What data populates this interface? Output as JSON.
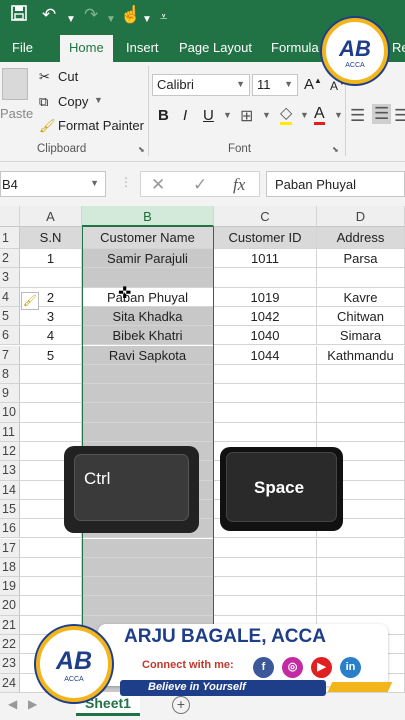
{
  "quick_access": {
    "save_icon": "save-icon",
    "undo_icon": "undo-icon",
    "redo_icon": "redo-icon",
    "touch_icon": "touch-mode-icon",
    "customize_icon": "customize-icon"
  },
  "tabs": [
    {
      "label": "File"
    },
    {
      "label": "Home"
    },
    {
      "label": "Insert"
    },
    {
      "label": "Page Layout"
    },
    {
      "label": "Formula"
    },
    {
      "label": "Re"
    }
  ],
  "clipboard": {
    "paste": "Paste",
    "cut": "Cut",
    "copy": "Copy",
    "format_painter": "Format Painter",
    "group": "Clipboard"
  },
  "font": {
    "name": "Calibri",
    "size": "11",
    "bold": "B",
    "italic": "I",
    "underline": "U",
    "font_color": "A",
    "group": "Font"
  },
  "formula_bar": {
    "name_box": "B4",
    "cancel": "✕",
    "enter": "✓",
    "fx": "fx",
    "value": "Paban Phuyal"
  },
  "columns": [
    "A",
    "B",
    "C",
    "D"
  ],
  "rows": [
    "1",
    "2",
    "3",
    "4",
    "5",
    "6",
    "7",
    "8",
    "9",
    "10",
    "11",
    "12",
    "13",
    "14",
    "15",
    "16",
    "17",
    "18",
    "19",
    "20",
    "21",
    "22",
    "23",
    "24"
  ],
  "table": {
    "headers": [
      "S.N",
      "Customer Name",
      "Customer ID",
      "Address"
    ],
    "data": [
      [
        "1",
        "Samir Parajuli",
        "1011",
        "Parsa"
      ],
      [
        "",
        "",
        "",
        ""
      ],
      [
        "2",
        "Paban Phuyal",
        "1019",
        "Kavre"
      ],
      [
        "3",
        "Sita Khadka",
        "1042",
        "Chitwan"
      ],
      [
        "4",
        "Bibek Khatri",
        "1040",
        "Simara"
      ],
      [
        "5",
        "Ravi Sapkota",
        "1044",
        "Kathmandu"
      ]
    ]
  },
  "keys": {
    "ctrl": "Ctrl",
    "space": "Space"
  },
  "banner": {
    "name": "ARJU BAGALE, ACCA",
    "connect": "Connect with me:",
    "slogan": "Believe in Yourself",
    "logo_text": "AB",
    "logo_sub": "ACCA"
  },
  "socials": [
    {
      "icon": "facebook-icon",
      "glyph": "f",
      "color": "#3b5998"
    },
    {
      "icon": "instagram-icon",
      "glyph": "◎",
      "color": "#c32aa3"
    },
    {
      "icon": "youtube-icon",
      "glyph": "▶",
      "color": "#e02020"
    },
    {
      "icon": "linkedin-icon",
      "glyph": "in",
      "color": "#2a7fc9"
    }
  ],
  "sheet": {
    "name": "Sheet1",
    "add": "+"
  },
  "colors": {
    "excel_green": "#217346",
    "logo_gold": "#f2b51c",
    "logo_blue": "#1f3e8a"
  }
}
